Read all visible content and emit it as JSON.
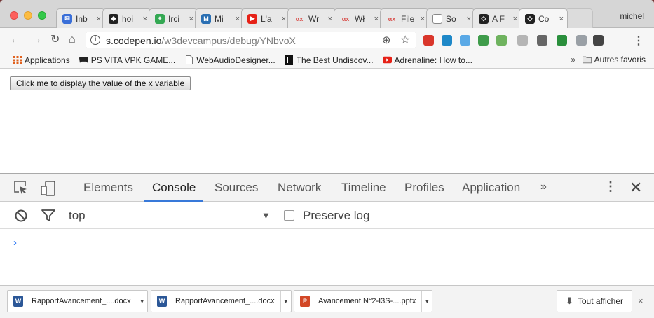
{
  "browser": {
    "profile_name": "michel",
    "tabs": [
      {
        "title": "Inb",
        "icon": "mail-icon",
        "color": "#3a6fd8"
      },
      {
        "title": "hoi",
        "icon": "gamepad-icon",
        "color": "#222222"
      },
      {
        "title": "Irci",
        "icon": "maps-icon",
        "color": "#34a853"
      },
      {
        "title": "Mi",
        "icon": "m-badge-icon",
        "color": "#2a6fb3"
      },
      {
        "title": "L'a",
        "icon": "youtube-icon",
        "color": "#e62117"
      },
      {
        "title": "Wr",
        "icon": "ax-icon",
        "color": "#d9534f"
      },
      {
        "title": "Wł",
        "icon": "ax-icon",
        "color": "#d9534f"
      },
      {
        "title": "File",
        "icon": "ax-icon",
        "color": "#d9534f"
      },
      {
        "title": "So",
        "icon": "document-icon",
        "color": "#888888"
      },
      {
        "title": "A F",
        "icon": "codepen-icon",
        "color": "#222222"
      },
      {
        "title": "Co",
        "icon": "codepen-icon",
        "color": "#222222",
        "active": true
      }
    ],
    "close_glyph": "×",
    "url_host": "s.codepen.io",
    "url_path": "/w3devcampus/debug/YNbvoX",
    "extension_colors": [
      "#d9362b",
      "#1e88c8",
      "#5aa9e6",
      "#3f9c4b",
      "#6fb35f",
      "#b5b5b5",
      "#666666",
      "#2a8f3c",
      "#9aa0a6",
      "#444444"
    ]
  },
  "bookmarks": {
    "items": [
      {
        "label": "Applications",
        "icon": "apps-grid-icon"
      },
      {
        "label": "PS VITA VPK GAME...",
        "icon": "gamepad-icon"
      },
      {
        "label": "WebAudioDesigner...",
        "icon": "document-icon"
      },
      {
        "label": "The Best Undiscov...",
        "icon": "dark-page-icon"
      },
      {
        "label": "Adrenaline: How to...",
        "icon": "youtube-icon"
      }
    ],
    "overflow": "»",
    "other_label": "Autres favoris"
  },
  "page": {
    "button_label": "Click me to display the value of the x variable"
  },
  "devtools": {
    "tabs": [
      "Elements",
      "Console",
      "Sources",
      "Network",
      "Timeline",
      "Profiles",
      "Application"
    ],
    "active_tab": "Console",
    "more": "»",
    "context": "top",
    "preserve_log_label": "Preserve log",
    "preserve_log_checked": false,
    "prompt_glyph": "›"
  },
  "downloads": {
    "items": [
      {
        "name": "RapportAvancement_....docx",
        "type": "word",
        "color": "#2b5797"
      },
      {
        "name": "RapportAvancement_....docx",
        "type": "word",
        "color": "#2b5797"
      },
      {
        "name": "Avancement N°2-I3S-....pptx",
        "type": "powerpoint",
        "color": "#d24726"
      }
    ],
    "show_all_label": "Tout afficher",
    "close_glyph": "×"
  }
}
